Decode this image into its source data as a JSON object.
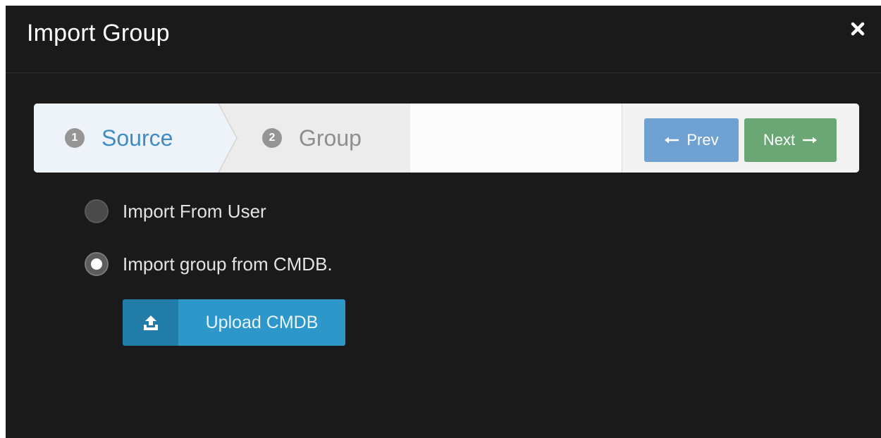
{
  "modal": {
    "title": "Import Group",
    "close_icon": "close-icon"
  },
  "wizard": {
    "steps": [
      {
        "number": "1",
        "label": "Source",
        "active": true
      },
      {
        "number": "2",
        "label": "Group",
        "active": false
      }
    ],
    "prev_label": "Prev",
    "next_label": "Next",
    "prev_icon": "arrow-left-icon",
    "next_icon": "arrow-right-icon"
  },
  "options": [
    {
      "label": "Import From User",
      "selected": false
    },
    {
      "label": "Import group from CMDB.",
      "selected": true
    }
  ],
  "upload": {
    "label": "Upload CMDB",
    "icon": "upload-icon"
  },
  "colors": {
    "modal_bg": "#1a1a1a",
    "active_step": "#3f8cc4",
    "prev_button": "#6fa1d3",
    "next_button": "#6ba774",
    "upload_button": "#2c97c8"
  }
}
